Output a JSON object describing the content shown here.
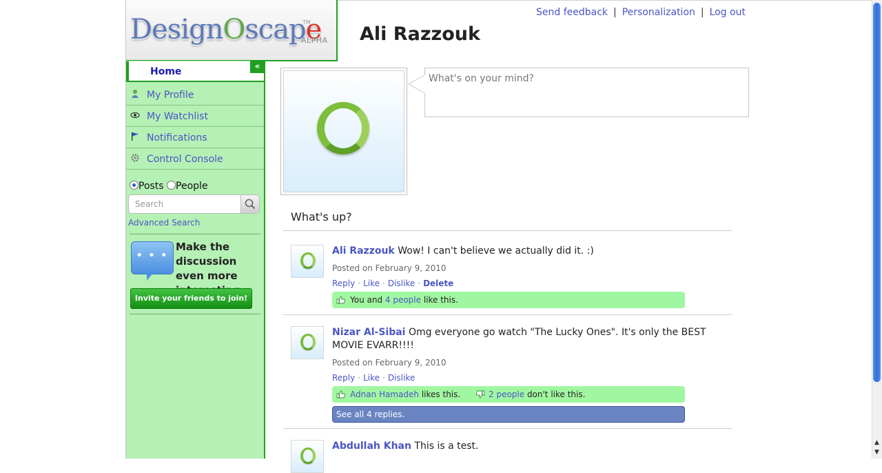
{
  "header": {
    "logo": {
      "brand": "DesignOscape",
      "tm": "TM",
      "edition": "ALPHA"
    },
    "user_name": "Ali Razzouk",
    "links": {
      "feedback": "Send feedback",
      "personalization": "Personalization",
      "logout": "Log out",
      "separator": "|"
    }
  },
  "sidebar": {
    "collapse_glyph": "«",
    "home": "Home",
    "items": [
      {
        "label": "My Profile",
        "icon": "person-icon"
      },
      {
        "label": "My Watchlist",
        "icon": "eye-icon"
      },
      {
        "label": "Notifications",
        "icon": "flag-icon"
      },
      {
        "label": "Control Console",
        "icon": "gear-icon"
      }
    ],
    "search": {
      "option_posts": "Posts",
      "option_people": "People",
      "selected": "Posts",
      "placeholder": "Search",
      "advanced": "Advanced Search"
    },
    "promo": {
      "dots": "• • •",
      "text": "Make the discussion even more interesting",
      "button": "Invite your friends to join!"
    }
  },
  "status": {
    "placeholder": "What's on your mind?"
  },
  "feed": {
    "title": "What's up?",
    "posts": [
      {
        "author": "Ali Razzouk",
        "text": "Wow! I can't believe we actually did it. :)",
        "date": "Posted on February 9, 2010",
        "actions": {
          "reply": "Reply",
          "like": "Like",
          "dislike": "Dislike",
          "delete": "Delete",
          "sep": "·"
        },
        "likes": {
          "prefix": "You and ",
          "link": "4 people",
          "suffix": " like this."
        }
      },
      {
        "author": "Nizar Al-Sibai",
        "text": "Omg everyone go watch \"The Lucky Ones\". It's only the BEST MOVIE EVARR!!!!",
        "date": "Posted on February 9, 2010",
        "actions": {
          "reply": "Reply",
          "like": "Like",
          "dislike": "Dislike",
          "sep": "·"
        },
        "likes": {
          "link": "Adnan Hamadeh",
          "suffix": " likes this."
        },
        "dislikes": {
          "link": "2 people",
          "suffix": " don't like this."
        },
        "replies": "See all 4 replies."
      },
      {
        "author": "Abdullah Khan",
        "text": "This is a test."
      }
    ]
  },
  "colors": {
    "accent_green": "#1fa01f",
    "sidebar_bg": "#b5f0b5",
    "link": "#4a56c4",
    "like_bar": "#a1f7a1",
    "replies_bar": "#6a84c2"
  }
}
